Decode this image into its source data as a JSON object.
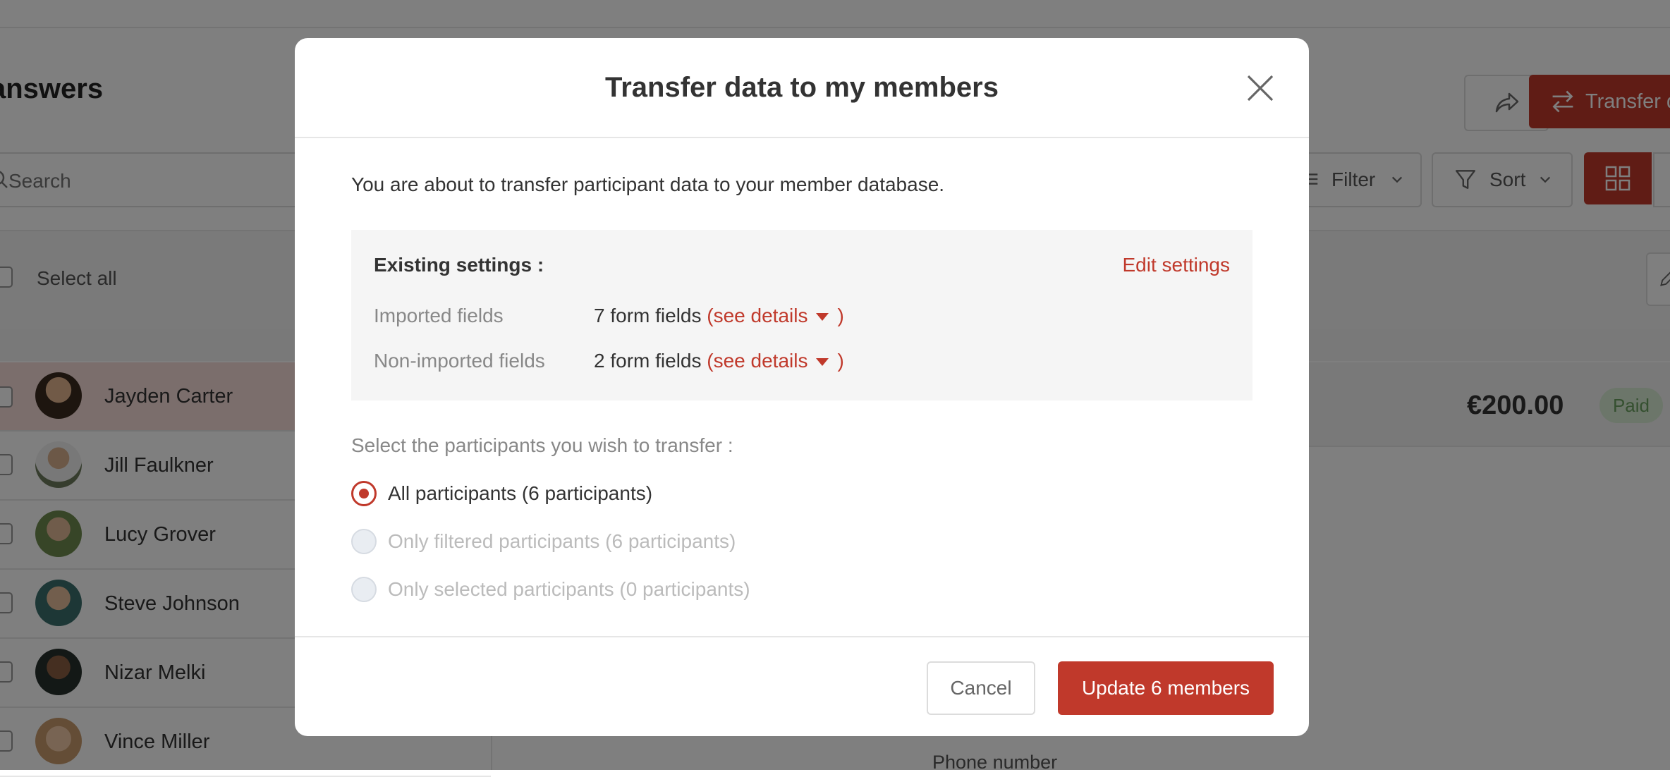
{
  "background": {
    "page_title": "answers",
    "search_placeholder": "Search",
    "select_all_label": "Select all",
    "participants": [
      {
        "name": "Jayden Carter",
        "selected": true
      },
      {
        "name": "Jill Faulkner",
        "selected": false
      },
      {
        "name": "Lucy Grover",
        "selected": false
      },
      {
        "name": "Steve Johnson",
        "selected": false
      },
      {
        "name": "Nizar Melki",
        "selected": false
      },
      {
        "name": "Vince Miller",
        "selected": false
      }
    ],
    "amount": "€200.00",
    "status_badge": "Paid",
    "phone_label": "Phone number",
    "transfer_button": "Transfer d",
    "filter_button": "Filter",
    "sort_button": "Sort"
  },
  "modal": {
    "title": "Transfer data to my members",
    "intro": "You are about to transfer participant data to your member database.",
    "settings": {
      "heading": "Existing settings :",
      "edit_link": "Edit settings",
      "rows": [
        {
          "label": "Imported fields",
          "value": "7 form fields",
          "details_open": "(see details",
          "details_close": ")"
        },
        {
          "label": "Non-imported fields",
          "value": "2 form fields",
          "details_open": "(see details",
          "details_close": ")"
        }
      ]
    },
    "select_label": "Select the participants you wish to transfer :",
    "options": [
      {
        "label": "All participants (6 participants)",
        "checked": true,
        "disabled": false
      },
      {
        "label": "Only filtered participants (6 participants)",
        "checked": false,
        "disabled": true
      },
      {
        "label": "Only selected participants (0 participants)",
        "checked": false,
        "disabled": true
      }
    ],
    "cancel_label": "Cancel",
    "confirm_label": "Update 6 members"
  },
  "colors": {
    "accent": "#c0392b",
    "overlay": "rgba(0,0,0,0.5)",
    "selected_row": "#f6dcd9",
    "paid_badge_bg": "#d9ecd4"
  },
  "icons": [
    "search-icon",
    "share-icon",
    "transfer-icon",
    "filter-icon",
    "chevron-down-icon",
    "funnel-icon",
    "grid-view-icon",
    "edit-icon",
    "close-icon",
    "caret-down-icon"
  ]
}
